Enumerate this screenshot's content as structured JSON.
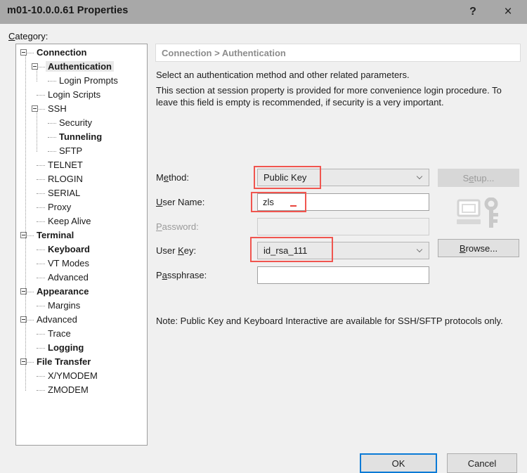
{
  "window": {
    "title": "m01-10.0.0.61 Properties",
    "help_icon": "?",
    "close_icon": "×"
  },
  "category_label_pre": "C",
  "category_label_post": "ategory:",
  "tree": {
    "items": [
      {
        "label": "Connection",
        "depth": 0,
        "bold": true,
        "selected": false,
        "expander": true
      },
      {
        "label": "Authentication",
        "depth": 1,
        "bold": true,
        "selected": true,
        "expander": true
      },
      {
        "label": "Login Prompts",
        "depth": 2,
        "bold": false,
        "selected": false,
        "expander": false
      },
      {
        "label": "Login Scripts",
        "depth": 1,
        "bold": false,
        "selected": false,
        "expander": false
      },
      {
        "label": "SSH",
        "depth": 1,
        "bold": false,
        "selected": false,
        "expander": true
      },
      {
        "label": "Security",
        "depth": 2,
        "bold": false,
        "selected": false,
        "expander": false
      },
      {
        "label": "Tunneling",
        "depth": 2,
        "bold": true,
        "selected": false,
        "expander": false
      },
      {
        "label": "SFTP",
        "depth": 2,
        "bold": false,
        "selected": false,
        "expander": false
      },
      {
        "label": "TELNET",
        "depth": 1,
        "bold": false,
        "selected": false,
        "expander": false
      },
      {
        "label": "RLOGIN",
        "depth": 1,
        "bold": false,
        "selected": false,
        "expander": false
      },
      {
        "label": "SERIAL",
        "depth": 1,
        "bold": false,
        "selected": false,
        "expander": false
      },
      {
        "label": "Proxy",
        "depth": 1,
        "bold": false,
        "selected": false,
        "expander": false
      },
      {
        "label": "Keep Alive",
        "depth": 1,
        "bold": false,
        "selected": false,
        "expander": false
      },
      {
        "label": "Terminal",
        "depth": 0,
        "bold": true,
        "selected": false,
        "expander": true
      },
      {
        "label": "Keyboard",
        "depth": 1,
        "bold": true,
        "selected": false,
        "expander": false
      },
      {
        "label": "VT Modes",
        "depth": 1,
        "bold": false,
        "selected": false,
        "expander": false
      },
      {
        "label": "Advanced",
        "depth": 1,
        "bold": false,
        "selected": false,
        "expander": false
      },
      {
        "label": "Appearance",
        "depth": 0,
        "bold": true,
        "selected": false,
        "expander": true
      },
      {
        "label": "Margins",
        "depth": 1,
        "bold": false,
        "selected": false,
        "expander": false
      },
      {
        "label": "Advanced",
        "depth": 0,
        "bold": false,
        "selected": false,
        "expander": true
      },
      {
        "label": "Trace",
        "depth": 1,
        "bold": false,
        "selected": false,
        "expander": false
      },
      {
        "label": "Logging",
        "depth": 1,
        "bold": true,
        "selected": false,
        "expander": false
      },
      {
        "label": "File Transfer",
        "depth": 0,
        "bold": true,
        "selected": false,
        "expander": true
      },
      {
        "label": "X/YMODEM",
        "depth": 1,
        "bold": false,
        "selected": false,
        "expander": false
      },
      {
        "label": "ZMODEM",
        "depth": 1,
        "bold": false,
        "selected": false,
        "expander": false
      }
    ]
  },
  "pane": {
    "breadcrumb": "Connection > Authentication",
    "description_1": "Select an authentication method and other related parameters.",
    "description_2": "This section at session property is provided for more convenience login procedure. To leave this field is empty is recommended, if security is a very important.",
    "note": "Note: Public Key and Keyboard Interactive are available for SSH/SFTP protocols only."
  },
  "form": {
    "method": {
      "label_pre": "M",
      "label_mn": "e",
      "label_post": "thod:",
      "value": "Public Key",
      "highlighted": true
    },
    "user_name": {
      "label_pre": "",
      "label_mn": "U",
      "label_post": "ser Name:",
      "value": "zls",
      "placeholder": "",
      "highlighted": true
    },
    "password": {
      "label_pre": "",
      "label_mn": "P",
      "label_post": "assword:",
      "value": "",
      "placeholder": "",
      "disabled": true
    },
    "user_key": {
      "label_pre": "User ",
      "label_mn": "K",
      "label_post": "ey:",
      "value": "id_rsa_111",
      "highlighted": true
    },
    "passphrase": {
      "label_pre": "P",
      "label_mn": "a",
      "label_post": "ssphrase:",
      "value": "",
      "placeholder": ""
    }
  },
  "buttons": {
    "setup_pre": "S",
    "setup_mn": "e",
    "setup_post": "tup...",
    "browse_pre": "",
    "browse_mn": "B",
    "browse_post": "rowse...",
    "ok": "OK",
    "cancel": "Cancel"
  },
  "icons": {
    "key_icon": "monitor-key-icon"
  },
  "colors": {
    "annotation_red": "#f0554f",
    "focus_blue": "#0a7ad6",
    "titlebar": "#a8a8a8",
    "dialog_bg": "#f0f0f0"
  }
}
